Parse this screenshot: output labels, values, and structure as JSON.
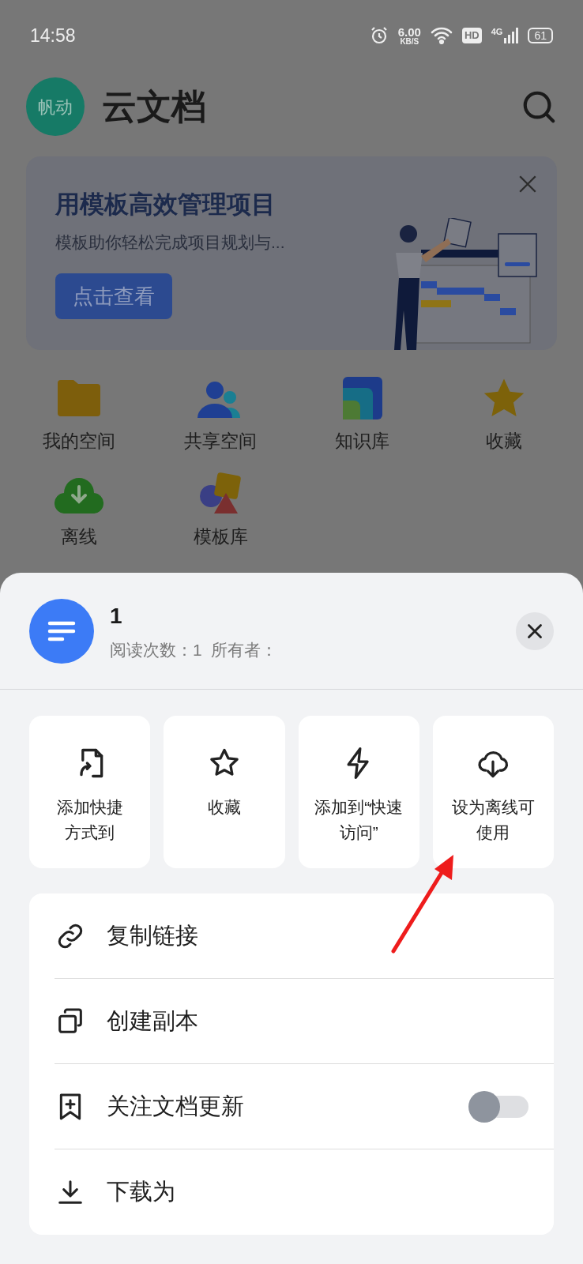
{
  "status_bar": {
    "time": "14:58",
    "speed": "6.00",
    "speed_unit": "KB/S",
    "hd": "HD",
    "network": "4G",
    "battery": "61"
  },
  "header": {
    "avatar_text": "帆动",
    "title": "云文档"
  },
  "banner": {
    "title": "用模板高效管理项目",
    "subtitle": "模板助你轻松完成项目规划与...",
    "button": "点击查看"
  },
  "shortcuts": [
    {
      "label": "我的空间",
      "kind": "folder"
    },
    {
      "label": "共享空间",
      "kind": "people"
    },
    {
      "label": "知识库",
      "kind": "library"
    },
    {
      "label": "收藏",
      "kind": "star"
    },
    {
      "label": "离线",
      "kind": "cloud"
    },
    {
      "label": "模板库",
      "kind": "shapes"
    }
  ],
  "sheet": {
    "doc_title": "1",
    "meta": "阅读次数：1  所有者：",
    "actions": [
      {
        "lines": [
          "添加快捷",
          "方式到"
        ],
        "kind": "shortcut"
      },
      {
        "lines": [
          "收藏"
        ],
        "kind": "star"
      },
      {
        "lines": [
          "添加到“快速",
          "访问”"
        ],
        "kind": "bolt"
      },
      {
        "lines": [
          "设为离线可",
          "使用"
        ],
        "kind": "cloud"
      }
    ],
    "menu": [
      {
        "label": "复制链接",
        "kind": "link"
      },
      {
        "label": "创建副本",
        "kind": "copy"
      },
      {
        "label": "关注文档更新",
        "kind": "follow",
        "on": false
      },
      {
        "label": "下载为",
        "kind": "download"
      }
    ]
  }
}
